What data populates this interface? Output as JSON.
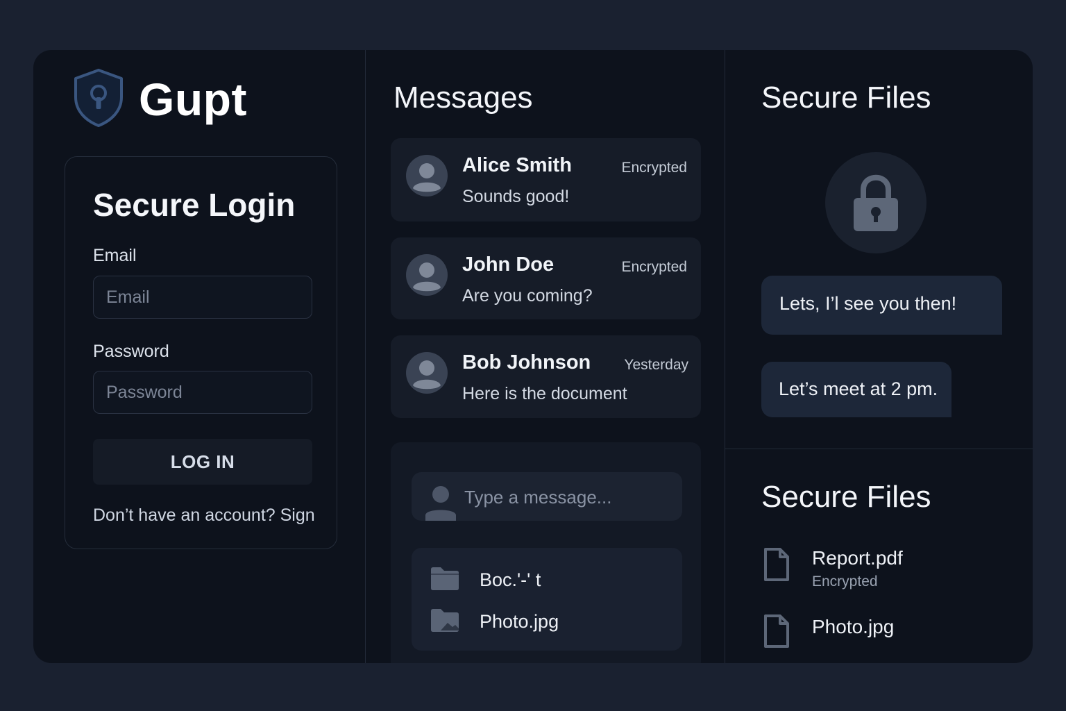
{
  "app": {
    "brand_name": "Gupt",
    "accent_color": "#2c4a75",
    "background": "#0d121c"
  },
  "login": {
    "title": "Secure Login",
    "email_label": "Email",
    "email_placeholder": "Email",
    "email_value": "",
    "password_label": "Password",
    "password_placeholder": "Password",
    "password_value": "",
    "login_button": "LOG IN",
    "signup_prompt": "Don’t have an account? Sign"
  },
  "messages": {
    "title": "Messages",
    "conversations": [
      {
        "name": "Alice Smith",
        "preview": "Sounds good!",
        "status": "Encrypted",
        "icon": "user-avatar-icon"
      },
      {
        "name": "John Doe",
        "preview": "Are you coming?",
        "status": "Encrypted",
        "icon": "user-avatar-icon"
      },
      {
        "name": "Bob Johnson",
        "preview": "Here is the document",
        "status": "Yesterday",
        "icon": "user-avatar-icon"
      }
    ],
    "composer": {
      "placeholder": "Type a message..."
    },
    "attachments": [
      {
        "name": "Boc.'-' t",
        "icon": "folder-icon"
      },
      {
        "name": "Photo.jpg",
        "icon": "image-folder-icon"
      }
    ]
  },
  "secure_files_top": {
    "title": "Secure Files",
    "lock_icon": "padlock-icon",
    "bubbles": [
      "Lets, I’l see you then!",
      "Let’s meet at 2 pm."
    ]
  },
  "secure_files_bottom": {
    "title": "Secure Files",
    "files": [
      {
        "name": "Report.pdf",
        "status": "Encrypted",
        "icon": "document-icon"
      },
      {
        "name": "Photo.jpg",
        "status": "",
        "icon": "document-icon"
      }
    ]
  }
}
